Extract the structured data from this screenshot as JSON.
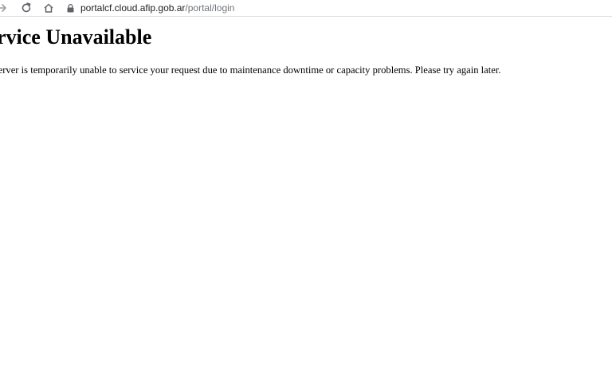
{
  "browser": {
    "url_host": "portalcf.cloud.afip.gob.ar",
    "url_path": "/portal/login",
    "icons": {
      "forward": "forward-arrow-icon",
      "reload": "reload-icon",
      "home": "home-icon",
      "lock": "lock-icon"
    }
  },
  "page": {
    "heading": "Service Unavailable",
    "message": "The server is temporarily unable to service your request due to maintenance downtime or capacity problems. Please try again later."
  }
}
